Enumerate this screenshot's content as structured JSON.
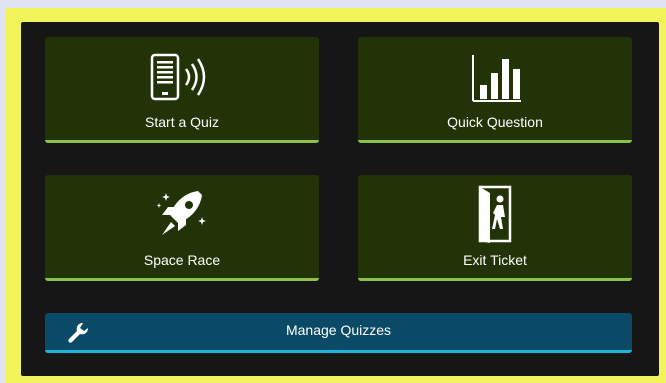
{
  "tiles": {
    "start_quiz": {
      "label": "Start a Quiz",
      "icon": "tablet-broadcast-icon"
    },
    "quick_question": {
      "label": "Quick Question",
      "icon": "bar-chart-icon"
    },
    "space_race": {
      "label": "Space Race",
      "icon": "rocket-icon"
    },
    "exit_ticket": {
      "label": "Exit Ticket",
      "icon": "exit-door-icon"
    }
  },
  "manage": {
    "label": "Manage Quizzes",
    "icon": "wrench-icon"
  },
  "colors": {
    "page_bg": "#dfe3f2",
    "frame_border": "#f1f55a",
    "panel_bg": "#161616",
    "tile_bg": "#223307",
    "tile_accent": "#8bc34a",
    "manage_bg": "#0b4a66",
    "manage_accent": "#19b6dc"
  }
}
